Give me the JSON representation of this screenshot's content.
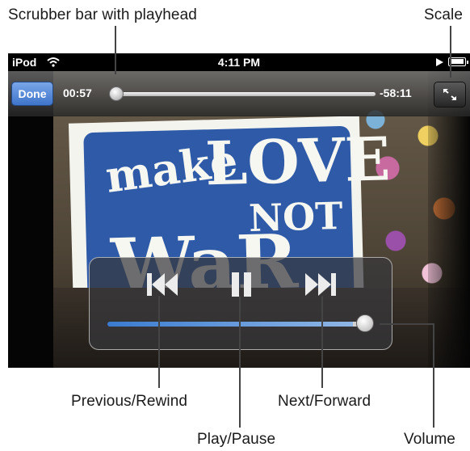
{
  "annotations": {
    "scrubber_bar": "Scrubber bar with playhead",
    "scale": "Scale",
    "previous_rewind": "Previous/Rewind",
    "next_forward": "Next/Forward",
    "play_pause": "Play/Pause",
    "volume": "Volume"
  },
  "status_bar": {
    "carrier": "iPod",
    "time": "4:11 PM"
  },
  "player": {
    "done_label": "Done",
    "elapsed": "00:57",
    "remaining": "-58:11",
    "progress_fraction": 0.017,
    "volume_fraction": 0.95
  },
  "video_sign": {
    "make": "make",
    "love": "LOVE",
    "not": "NOT",
    "war": "WaR"
  },
  "icons": {
    "wifi": "wifi-icon",
    "battery": "battery-icon",
    "play_indicator": "play-indicator-icon",
    "scale": "expand-arrows-icon",
    "previous": "skip-back-icon",
    "pause": "pause-icon",
    "next": "skip-forward-icon"
  },
  "colors": {
    "done_button": "#3f74c9",
    "scrubber_progress": "#3a79c9",
    "volume_fill": "#3a7bd0",
    "sign_blue": "#2e5aa8"
  }
}
